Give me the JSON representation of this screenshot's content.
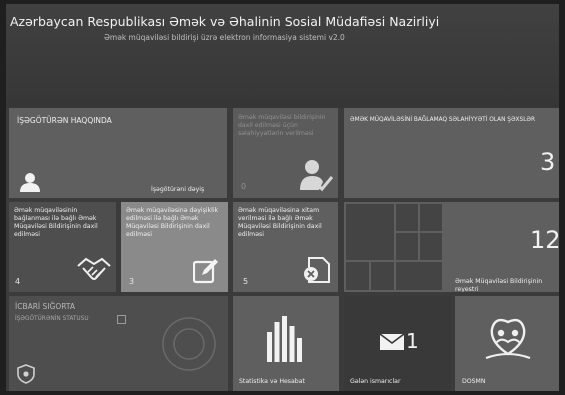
{
  "header": {
    "title": "Azərbaycan Respublikası Əmək və Əhalinin Sosial Müdafiəsi Nazirliyi",
    "subtitle": "Əmək müqaviləsi bildirişi üzrə elektron informasiya sistemi v2.0"
  },
  "tiles": {
    "employer": {
      "title": "İŞƏGÖTÜRƏN HAQQINDA",
      "action": "İşəgötürəni dəyiş"
    },
    "unconfirmed": {
      "label": "Əmək müqaviləsi bildirişinin daxil edilməsi üçün səlahiyyətlərin verilməsi",
      "count": "0"
    },
    "authorized_persons": {
      "label": "ƏMƏK MÜQAVİLƏSİNİ BAĞLAMAQ SƏLAHİYYƏTİ OLAN ŞƏXSLƏR",
      "count": "3"
    },
    "conclusion": {
      "label": "Əmək müqaviləsinin bağlanması ilə bağlı Əmək Müqaviləsi Bildirişinin daxil edilməsi",
      "count": "4"
    },
    "modification": {
      "label": "Əmək müqaviləsinə dəyişiklik edilməsi ilə bağlı Əmək Müqaviləsi Bildirişinin daxil edilməsi",
      "count": "3"
    },
    "termination": {
      "label": "Əmək müqaviləsinə xitam verilməsi ilə bağlı Əmək Müqaviləsi Bildirişinin daxil edilməsi",
      "count": "5"
    },
    "registry": {
      "label": "Əmək Müqaviləsi Bildirişinin reyestri",
      "count": "12"
    },
    "insurance": {
      "title": "İCBARİ SIĞORTA",
      "status_label": "İŞƏGÖTÜRƏNİN STATUSU"
    },
    "statistics": {
      "label": "Statistika və Hesabat"
    },
    "messages": {
      "label": "Gələn ismarıclar",
      "count": "1"
    },
    "dosmn": {
      "label": "DOSMN"
    }
  }
}
